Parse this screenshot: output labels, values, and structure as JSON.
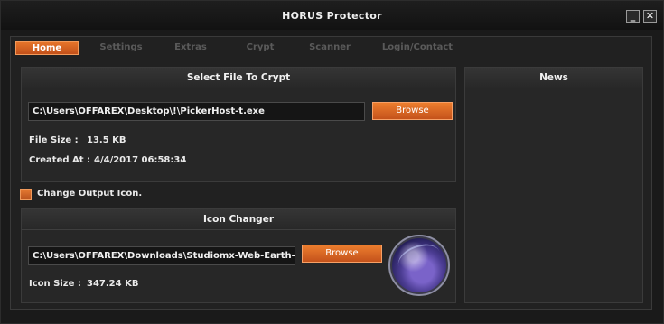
{
  "window": {
    "title": "HORUS  Protector",
    "minimize_label": "_",
    "close_label": "✕"
  },
  "tabs": [
    {
      "label": "Home",
      "active": true
    },
    {
      "label": "Settings",
      "active": false
    },
    {
      "label": "Extras",
      "active": false
    },
    {
      "label": "Crypt",
      "active": false
    },
    {
      "label": "Scanner",
      "active": false
    },
    {
      "label": "Login/Contact",
      "active": false
    }
  ],
  "select_file": {
    "header": "Select File To Crypt",
    "path": "C:\\Users\\OFFAREX\\Desktop\\!\\PickerHost-t.exe",
    "browse_label": "Browse",
    "file_size_label": "File Size :",
    "file_size_value": "13.5 KB",
    "created_at_label": "Created At :",
    "created_at_value": "4/4/2017 06:58:34"
  },
  "change_icon": {
    "label": "Change Output Icon."
  },
  "icon_changer": {
    "header": "Icon Changer",
    "path": "C:\\Users\\OFFAREX\\Downloads\\Studiomx-Web-Earth-Sca",
    "browse_label": "Browse",
    "icon_size_label": "Icon Size :",
    "icon_size_value": "347.24 KB",
    "preview_icon": "globe-icon"
  },
  "news": {
    "header": "News"
  },
  "colors": {
    "accent": "#e06a24",
    "background": "#1a1a1a"
  }
}
